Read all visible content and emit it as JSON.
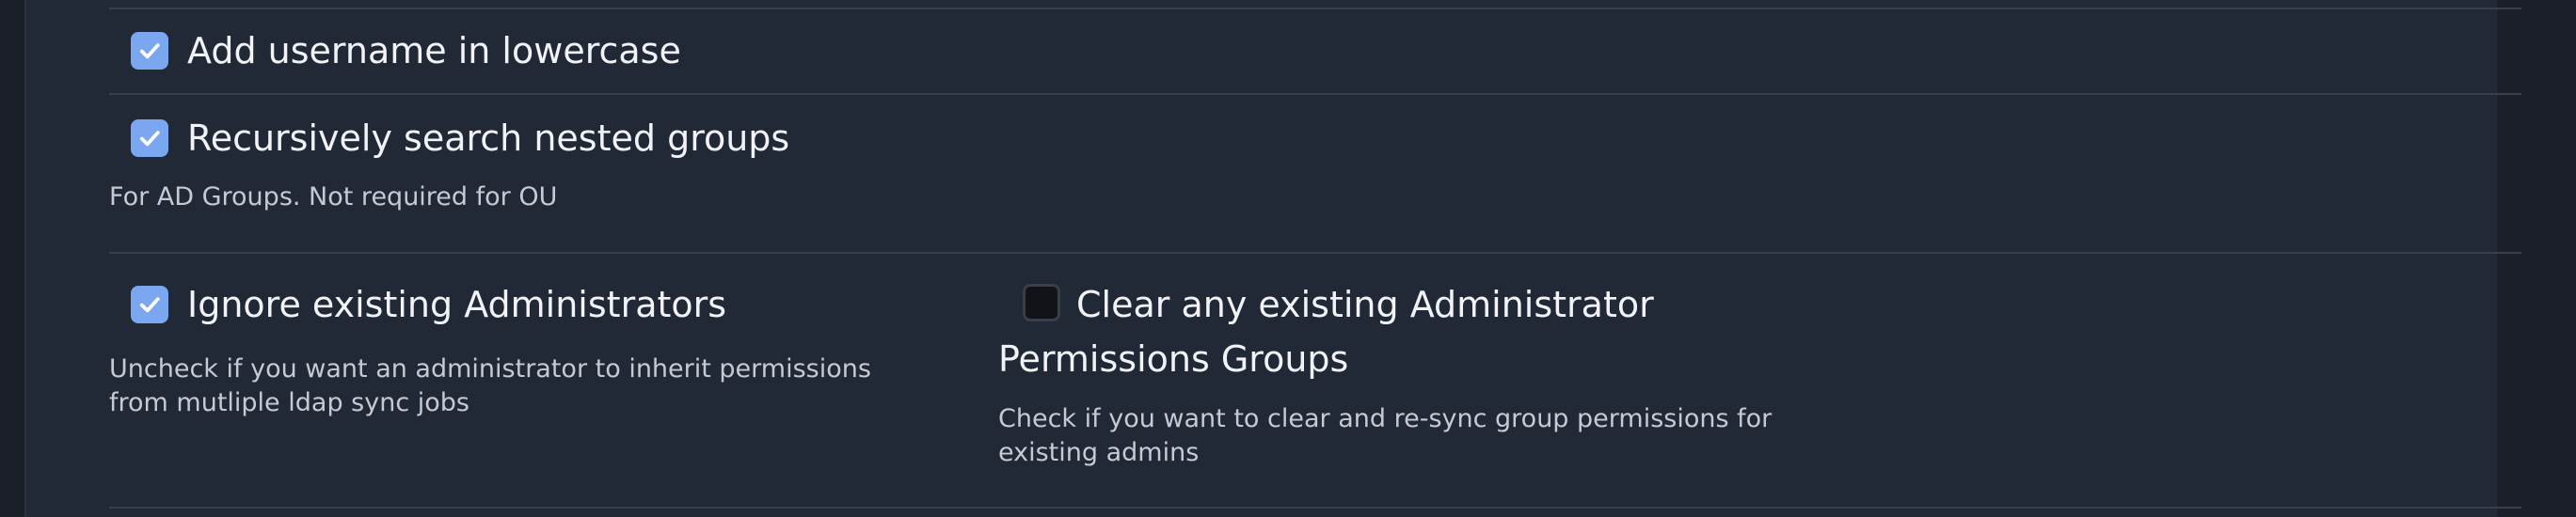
{
  "options": {
    "lowercase": {
      "label": "Add username in lowercase",
      "checked": true
    },
    "nested_groups": {
      "label": "Recursively search nested groups",
      "checked": true,
      "help": "For AD Groups. Not required for OU"
    },
    "ignore_admins": {
      "label": "Ignore existing Administrators",
      "checked": true,
      "help": "Uncheck if you want an administrator to inherit permissions from mutliple ldap sync jobs"
    },
    "clear_admin_groups": {
      "label": "Clear any existing Administrator Permissions Groups",
      "checked": false,
      "help": "Check if you want to clear and re-sync group permissions for existing admins"
    }
  },
  "colors": {
    "checkbox_checked": "#7ba6f0",
    "checkbox_unchecked": "#111318",
    "panel_background": "#222936",
    "text_primary": "#f1f3f6",
    "text_secondary": "#c5cad3",
    "divider": "#383f4b"
  },
  "icons": {
    "checked": "checkmark-icon"
  }
}
